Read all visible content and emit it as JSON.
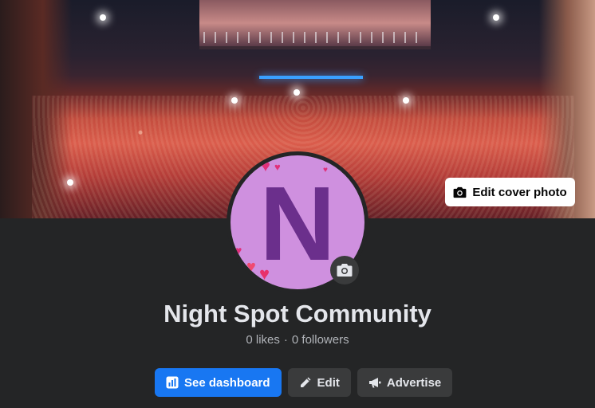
{
  "cover": {
    "edit_label": "Edit cover photo"
  },
  "avatar": {
    "letter": "N",
    "background": "#cf90df",
    "letter_color": "#6b2f8c"
  },
  "page": {
    "name": "Night Spot Community",
    "likes": "0 likes",
    "separator": "·",
    "followers": "0 followers"
  },
  "actions": {
    "dashboard_label": "See dashboard",
    "edit_label": "Edit",
    "advertise_label": "Advertise"
  },
  "colors": {
    "primary": "#1877f2",
    "surface": "#242526",
    "button": "#3a3b3c",
    "text": "#e4e6eb",
    "secondary_text": "#b0b3b8"
  },
  "icons": {
    "edit_cover": "camera-icon",
    "avatar_camera": "camera-icon",
    "dashboard": "dashboard-icon",
    "edit": "pencil-icon",
    "advertise": "megaphone-icon"
  }
}
